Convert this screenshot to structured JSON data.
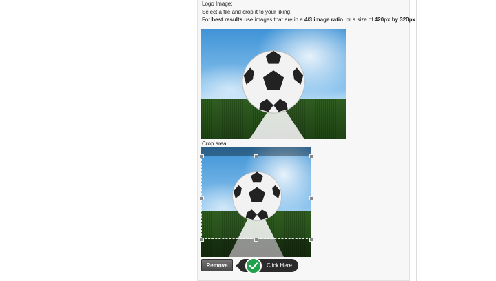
{
  "form": {
    "logo_label": "Logo Image:",
    "instructions": "Select a file and crop it to your liking.",
    "best_results": {
      "prefix": "For ",
      "strong1": "best results",
      "middle": " use images that are in a ",
      "strong2": "4/3 image ratio",
      "middle2": ". or a size of ",
      "strong3": "420px by 320px"
    },
    "crop_label": "Crop area:",
    "remove_label": "Remove",
    "callout_label": "Click Here"
  },
  "icons": {
    "check": "check-icon"
  },
  "colors": {
    "remove_button": "#555555",
    "callout_bg": "#2b2b2b",
    "check_green": "#1fa24a"
  }
}
